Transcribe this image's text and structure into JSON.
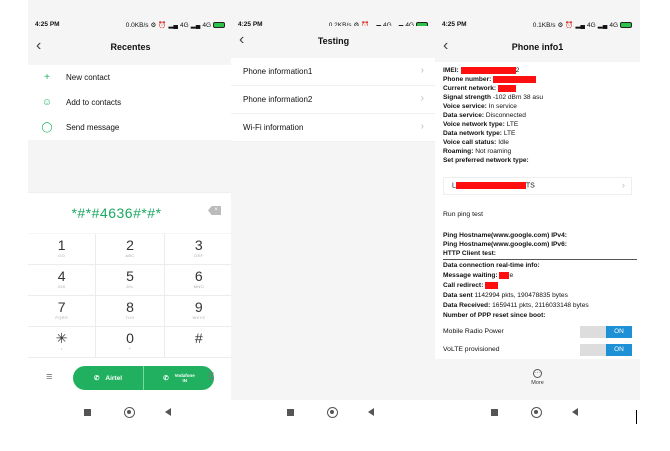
{
  "screens": [
    {
      "status": {
        "time": "4:25 PM",
        "speed": "0.0KB/s",
        "network": "4G",
        "network2": "4G"
      },
      "title": "Recentes",
      "menu": [
        {
          "icon": "plus-icon",
          "glyph": "+",
          "label": "New contact"
        },
        {
          "icon": "person-icon",
          "glyph": "☺",
          "label": "Add to contacts"
        },
        {
          "icon": "message-icon",
          "glyph": "◯",
          "label": "Send message"
        }
      ],
      "dialed": "*#*#4636#*#*",
      "keys": [
        {
          "digit": "1",
          "letters": "OO"
        },
        {
          "digit": "2",
          "letters": "ABC"
        },
        {
          "digit": "3",
          "letters": "DEF"
        },
        {
          "digit": "4",
          "letters": "GHI"
        },
        {
          "digit": "5",
          "letters": "JKL"
        },
        {
          "digit": "6",
          "letters": "MNO"
        },
        {
          "digit": "7",
          "letters": "PQRS"
        },
        {
          "digit": "8",
          "letters": "TUV"
        },
        {
          "digit": "9",
          "letters": "WXYZ"
        },
        {
          "digit": "✳",
          "letters": "•"
        },
        {
          "digit": "0",
          "letters": "+"
        },
        {
          "digit": "#",
          "letters": ""
        }
      ],
      "sim1": "Airtel",
      "sim2_line1": "Vodafone",
      "sim2_line2": "IN"
    },
    {
      "status": {
        "time": "4:25 PM",
        "speed": "0.2KB/s",
        "network": "4G",
        "network2": "4G"
      },
      "title": "Testing",
      "items": [
        "Phone information1",
        "Phone information2",
        "Wi-Fi information"
      ]
    },
    {
      "status": {
        "time": "4:25 PM",
        "speed": "0.1KB/s",
        "network": "4G",
        "network2": "4G"
      },
      "title": "Phone info1",
      "imei_label": "IMEI:",
      "imei_tail": "2",
      "phone_number_label": "Phone number:",
      "current_network_label": "Current network:",
      "signal_label": "Signal strength",
      "signal_value": "-102 dBm   38 asu",
      "voice_service_label": "Voice service:",
      "voice_service_value": "In service",
      "data_service_label": "Data service:",
      "data_service_value": "Disconnected",
      "voice_network_type_label": "Voice network type:",
      "voice_network_type_value": "LTE",
      "data_network_type_label": "Data network type:",
      "data_network_type_value": "LTE",
      "voice_call_label": "Voice call status:",
      "voice_call_value": "Idle",
      "roaming_label": "Roaming:",
      "roaming_value": "Not roaming",
      "preferred_label": "Set preferred network type:",
      "preferred_prefix": "L",
      "preferred_suffix": "TS",
      "ping_button": "Run ping test",
      "ping_v4": "Ping Hostname(www.google.com) IPv4:",
      "ping_v6": "Ping Hostname(www.google.com) IPv6:",
      "http_test": "HTTP Client test:",
      "data_conn": "Data connection real-time info:",
      "msg_waiting_label": "Message waiting:",
      "msg_waiting_tail": "e",
      "call_redirect_label": "Call redirect:",
      "data_sent_label": "Data sent",
      "data_sent_value": "1142994 pkts, 190478835 bytes",
      "data_received_label": "Data Received:",
      "data_received_value": "1659411 pkts, 2116033148 bytes",
      "ppp_label": "Number of PPP reset since boot:",
      "mobile_radio_label": "Mobile Radio Power",
      "mobile_radio_state": "ON",
      "volte_label": "VoLTE provisioned",
      "volte_state": "ON",
      "more_label": "More"
    }
  ],
  "colors": {
    "accent": "#20b060",
    "toggle_on": "#1e90d6",
    "redaction": "#ff1010"
  }
}
